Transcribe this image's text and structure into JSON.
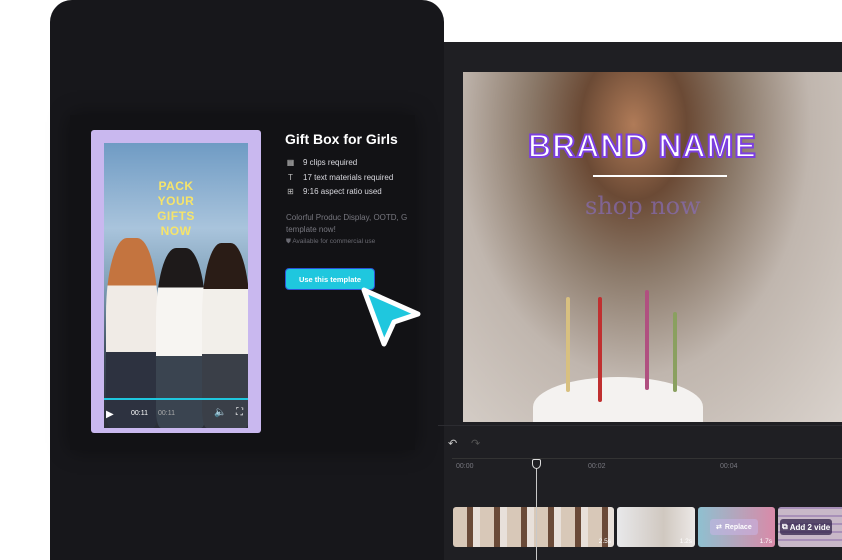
{
  "template": {
    "overlay_text": [
      "PACK",
      "YOUR",
      "GIFTS",
      "NOW"
    ],
    "player": {
      "current": "00:11",
      "total": "00:11",
      "progress": 1.0
    },
    "title": "Gift Box for Girls",
    "requirements": [
      {
        "icon": "film-icon",
        "label": "9 clips required"
      },
      {
        "icon": "text-icon",
        "label": "17 text materials required"
      },
      {
        "icon": "layout-icon",
        "label": "9:16 aspect ratio used"
      }
    ],
    "description": "Colorful Produc Display, OOTD, G template now!",
    "availability": "Available for commercial use",
    "use_button": "Use this template"
  },
  "editor": {
    "preview": {
      "brand": "BRAND NAME",
      "tagline": "shop now"
    },
    "timeline": {
      "ticks": [
        "00:00",
        "00:02",
        "00:04"
      ],
      "clips": [
        {
          "duration": "2.5s"
        },
        {
          "duration": "1.2s"
        },
        {
          "duration": "1.7s",
          "action": "Replace"
        },
        {
          "action": "Add 2 vide"
        }
      ]
    }
  },
  "colors": {
    "accent": "#1fc7de",
    "brand_stroke": "#7c3fe0"
  }
}
